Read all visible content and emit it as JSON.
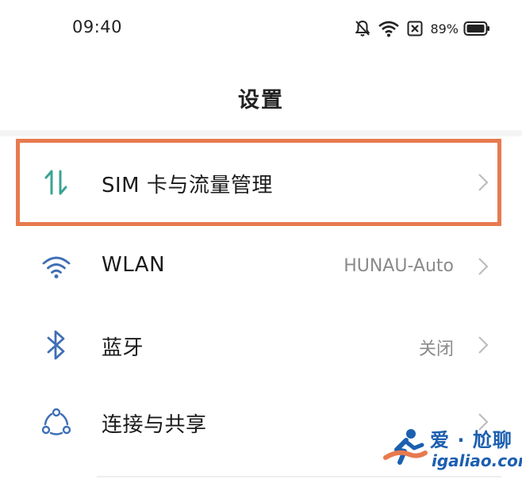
{
  "status_bar": {
    "time": "09:40",
    "battery_percent": "89%",
    "icons": [
      "bell-muted-icon",
      "wifi-icon",
      "sim-off-icon",
      "battery-icon"
    ]
  },
  "header": {
    "title": "设置"
  },
  "settings": [
    {
      "label": "SIM 卡与流量管理",
      "value": "",
      "icon": "data-transfer-icon",
      "highlighted": true
    },
    {
      "label": "WLAN",
      "value": "HUNAU-Auto",
      "icon": "wifi-icon"
    },
    {
      "label": "蓝牙",
      "value": "关闭",
      "icon": "bluetooth-icon"
    },
    {
      "label": "连接与共享",
      "value": "",
      "icon": "share-nodes-icon"
    }
  ],
  "watermark": {
    "title": "爱 · 尬聊",
    "url": "igaliao.com"
  },
  "colors": {
    "highlight": "#e77a4f",
    "sim_icon": "#3aa392",
    "icon_blue": "#3f6fb5",
    "watermark_blue": "#1b5fb0"
  }
}
